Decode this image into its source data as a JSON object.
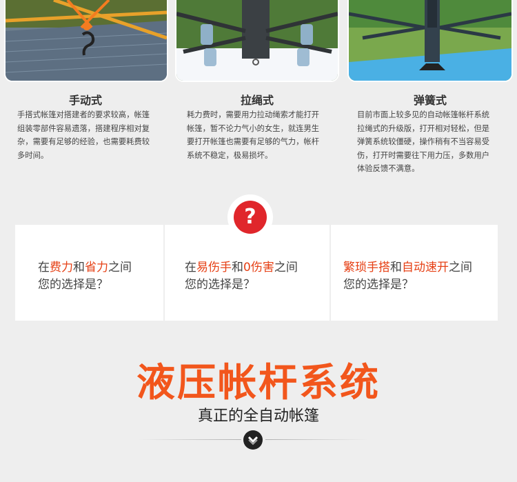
{
  "columns": [
    {
      "title": "手动式",
      "desc": [
        "手搭式帐篷对搭建者的要求较高，帐篷",
        "组装零部件容易遗落，搭建程序相对复",
        "杂，需要有足够的经验，也需要耗费较",
        "多时间。"
      ]
    },
    {
      "title": "拉绳式",
      "desc": [
        "耗力费时，需要用力拉动绳索才能打开",
        "帐篷，暂不论力气小的女生，就连男生",
        "要打开帐篷也需要有足够的气力，帐杆",
        "系统不稳定，极易损坏。"
      ]
    },
    {
      "title": "弹簧式",
      "desc": [
        "目前市面上较多见的自动帐篷帐杆系统",
        "拉绳式的升级版，打开相对轻松，但是",
        "弹簧系统较僵硬，操作稍有不当容易受",
        "伤，打开时需要往下用力压，多数用户",
        "体验反馈不满意。"
      ]
    }
  ],
  "question_mark": "?",
  "panels": [
    {
      "pre": "在",
      "hl1": "费力",
      "mid": "和",
      "hl2": "省力",
      "post": "之间",
      "line2": "您的选择是？"
    },
    {
      "pre": "在",
      "hl1": "易伤手",
      "mid": "和",
      "hl2": "0伤害",
      "post": "之间",
      "line2": "您的选择是？"
    },
    {
      "pre": "",
      "hl1": "繁琐手搭",
      "mid": "和",
      "hl2": "自动速开",
      "post": "之间",
      "line2": "您的选择是？"
    }
  ],
  "headline": "液压帐杆系统",
  "subheadline": "真正的全自动帐篷",
  "colors": {
    "background": "#eeeeee",
    "highlight": "#e64015",
    "headline": "#f2561c",
    "question_red": "#e0262b"
  },
  "icons": {
    "question": "question-mark-icon",
    "scroll_down": "chevron-down-icon"
  }
}
